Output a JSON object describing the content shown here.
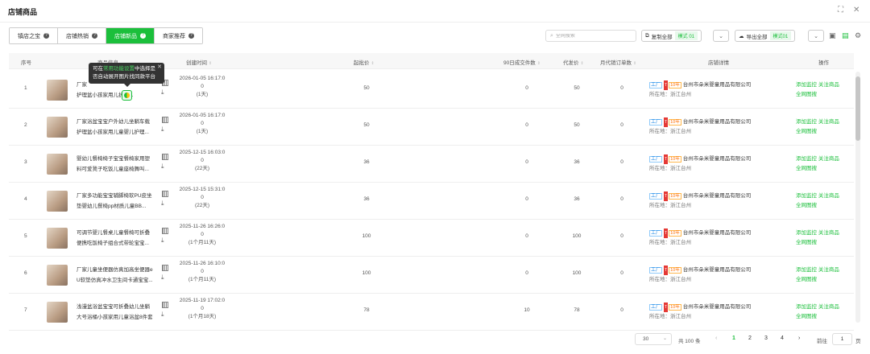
{
  "header": {
    "title": "店铺商品"
  },
  "tabs": [
    {
      "label": "镇店之宝"
    },
    {
      "label": "店铺热销"
    },
    {
      "label": "店铺新品"
    },
    {
      "label": "商家推荐"
    }
  ],
  "search": {
    "placeholder": "全网搜索"
  },
  "toolbar": {
    "copy_all": "复制全部",
    "copy_mode": "模式 01",
    "export_all": "导出全部",
    "export_mode": "模式01"
  },
  "columns": {
    "index": "序号",
    "product": "商品信息",
    "created": "创建时间",
    "start_price": "起批价",
    "sales90": "90日成交件数",
    "agent_price": "代发价",
    "monthly_orders": "月代销订单数",
    "shop": "店铺详情",
    "actions": "操作"
  },
  "tooltip": {
    "line1_a": "可在",
    "line1_link": "常用功能设置",
    "line1_b": "中选择是",
    "line2": "否自动展开图片找同款平台"
  },
  "rows": [
    {
      "index": "1",
      "name_l1": "厂家",
      "name_l2": "护理盆小孩家用儿",
      "name_l2b": "护理...",
      "date": "2026-01-05 16:17:0",
      "d0": "0",
      "days": "(1天)",
      "start_price": "50",
      "sales90": "0",
      "agent_price": "50",
      "monthly": "0"
    },
    {
      "index": "2",
      "name_l1": "厂家浴盆宝宝户外幼儿坐躺车载",
      "name_l2": "护理盆小孩家用儿童婴儿护理...",
      "name_l2b": "",
      "date": "2026-01-05 16:17:0",
      "d0": "0",
      "days": "(1天)",
      "start_price": "50",
      "sales90": "0",
      "agent_price": "50",
      "monthly": "0"
    },
    {
      "index": "3",
      "name_l1": "婴幼儿餐椅椅子宝宝餐椅家用塑",
      "name_l2": "料可爱凳子吃饭儿童座椅舞叫...",
      "name_l2b": "",
      "date": "2025-12-15 16:03:0",
      "d0": "0",
      "days": "(22天)",
      "start_price": "36",
      "sales90": "0",
      "agent_price": "36",
      "monthly": "0"
    },
    {
      "index": "4",
      "name_l1": "厂家多功能宝宝辅脚椅软PU皮坐",
      "name_l2": "垫婴幼儿餐椅pp材质儿童BB...",
      "name_l2b": "",
      "date": "2025-12-15 15:31:0",
      "d0": "0",
      "days": "(22天)",
      "start_price": "36",
      "sales90": "0",
      "agent_price": "36",
      "monthly": "0"
    },
    {
      "index": "5",
      "name_l1": "可调节婴儿餐桌儿童餐椅可折叠",
      "name_l2": "便携吃饭椅子组合式带轮宝宝...",
      "name_l2b": "",
      "date": "2025-11-26 16:26:0",
      "d0": "0",
      "days": "(1个月11天)",
      "start_price": "100",
      "sales90": "0",
      "agent_price": "100",
      "monthly": "0"
    },
    {
      "index": "6",
      "name_l1": "厂家儿童坐便器仿真加高坐便器e",
      "name_l2": "U软垫仿真冲水卫生间卡通宝宝...",
      "name_l2b": "",
      "date": "2025-11-26 16:10:0",
      "d0": "0",
      "days": "(1个月11天)",
      "start_price": "100",
      "sales90": "0",
      "agent_price": "100",
      "monthly": "0"
    },
    {
      "index": "7",
      "name_l1": "浅漫盆浴盆宝宝可折叠幼儿坐躺",
      "name_l2": "大号浴桶小孩家用儿童浴盆8件套",
      "name_l2b": "",
      "date": "2025-11-19 17:02:0",
      "d0": "0",
      "days": "(1个月18天)",
      "start_price": "78",
      "sales90": "10",
      "agent_price": "78",
      "monthly": "0"
    }
  ],
  "shop": {
    "factory": "工厂",
    "tmall": "T",
    "years": "10年",
    "name": "台州市朵米婴童用品有限公司",
    "loc_label": "所在地：",
    "loc": "浙江台州"
  },
  "actions": {
    "add_monitor": "添加监控",
    "follow": "关注商品",
    "image_search": "全网图搜"
  },
  "pagination": {
    "page_size": "30",
    "total": "共 100 条",
    "pages": [
      "1",
      "2",
      "3",
      "4"
    ],
    "current": "1",
    "goto_label": "前往",
    "goto_value": "1",
    "goto_unit": "页"
  }
}
